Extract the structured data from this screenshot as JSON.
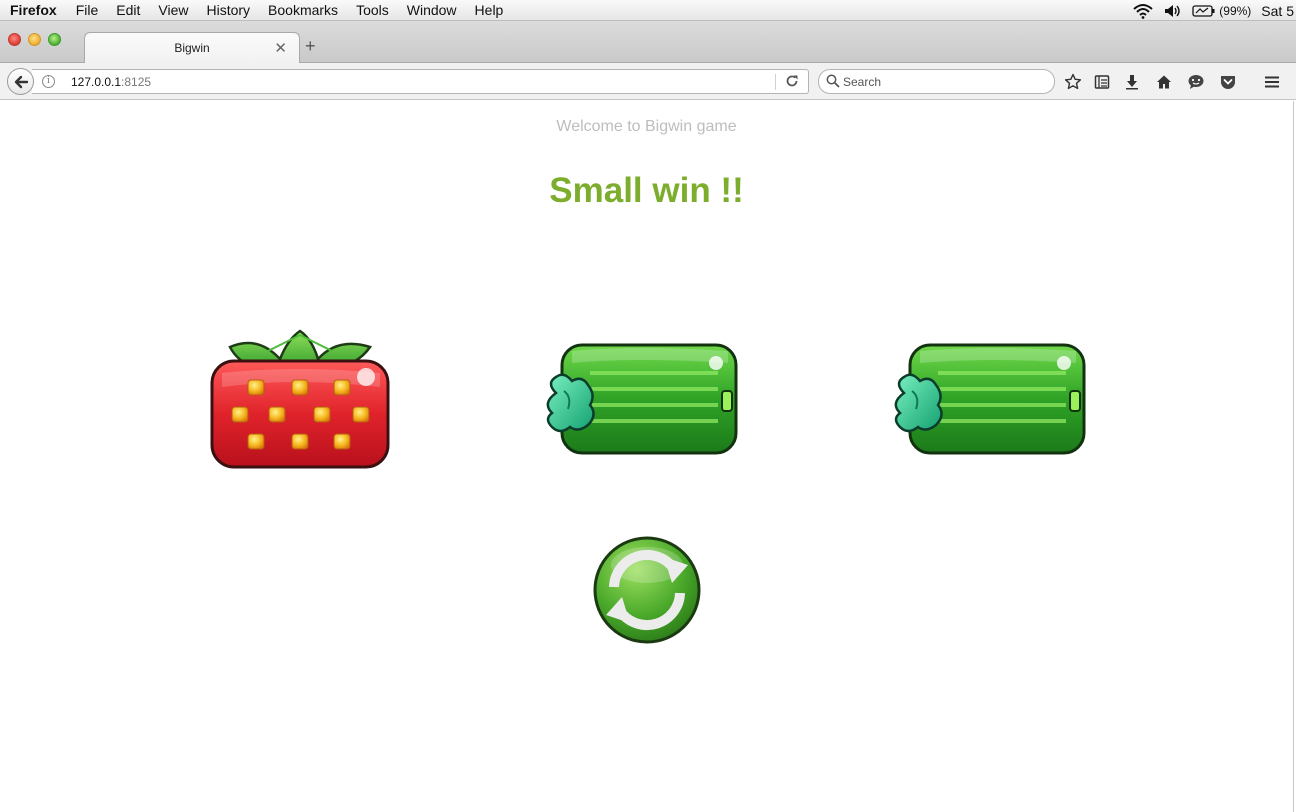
{
  "menubar": {
    "app_name": "Firefox",
    "items": [
      "File",
      "Edit",
      "View",
      "History",
      "Bookmarks",
      "Tools",
      "Window",
      "Help"
    ],
    "battery": "(99%)",
    "clock": "Sat 5"
  },
  "browser": {
    "tab_title": "Bigwin",
    "url_host": "127.0.0.1",
    "url_port": ":8125",
    "search_placeholder": "Search"
  },
  "page": {
    "welcome": "Welcome to Bigwin game",
    "result": "Small win !!",
    "reels": [
      "strawberry",
      "cucumber",
      "cucumber"
    ],
    "spin_icon": "refresh-icon"
  },
  "colors": {
    "result": "#7cad2d",
    "welcome": "#bdbdbd"
  }
}
